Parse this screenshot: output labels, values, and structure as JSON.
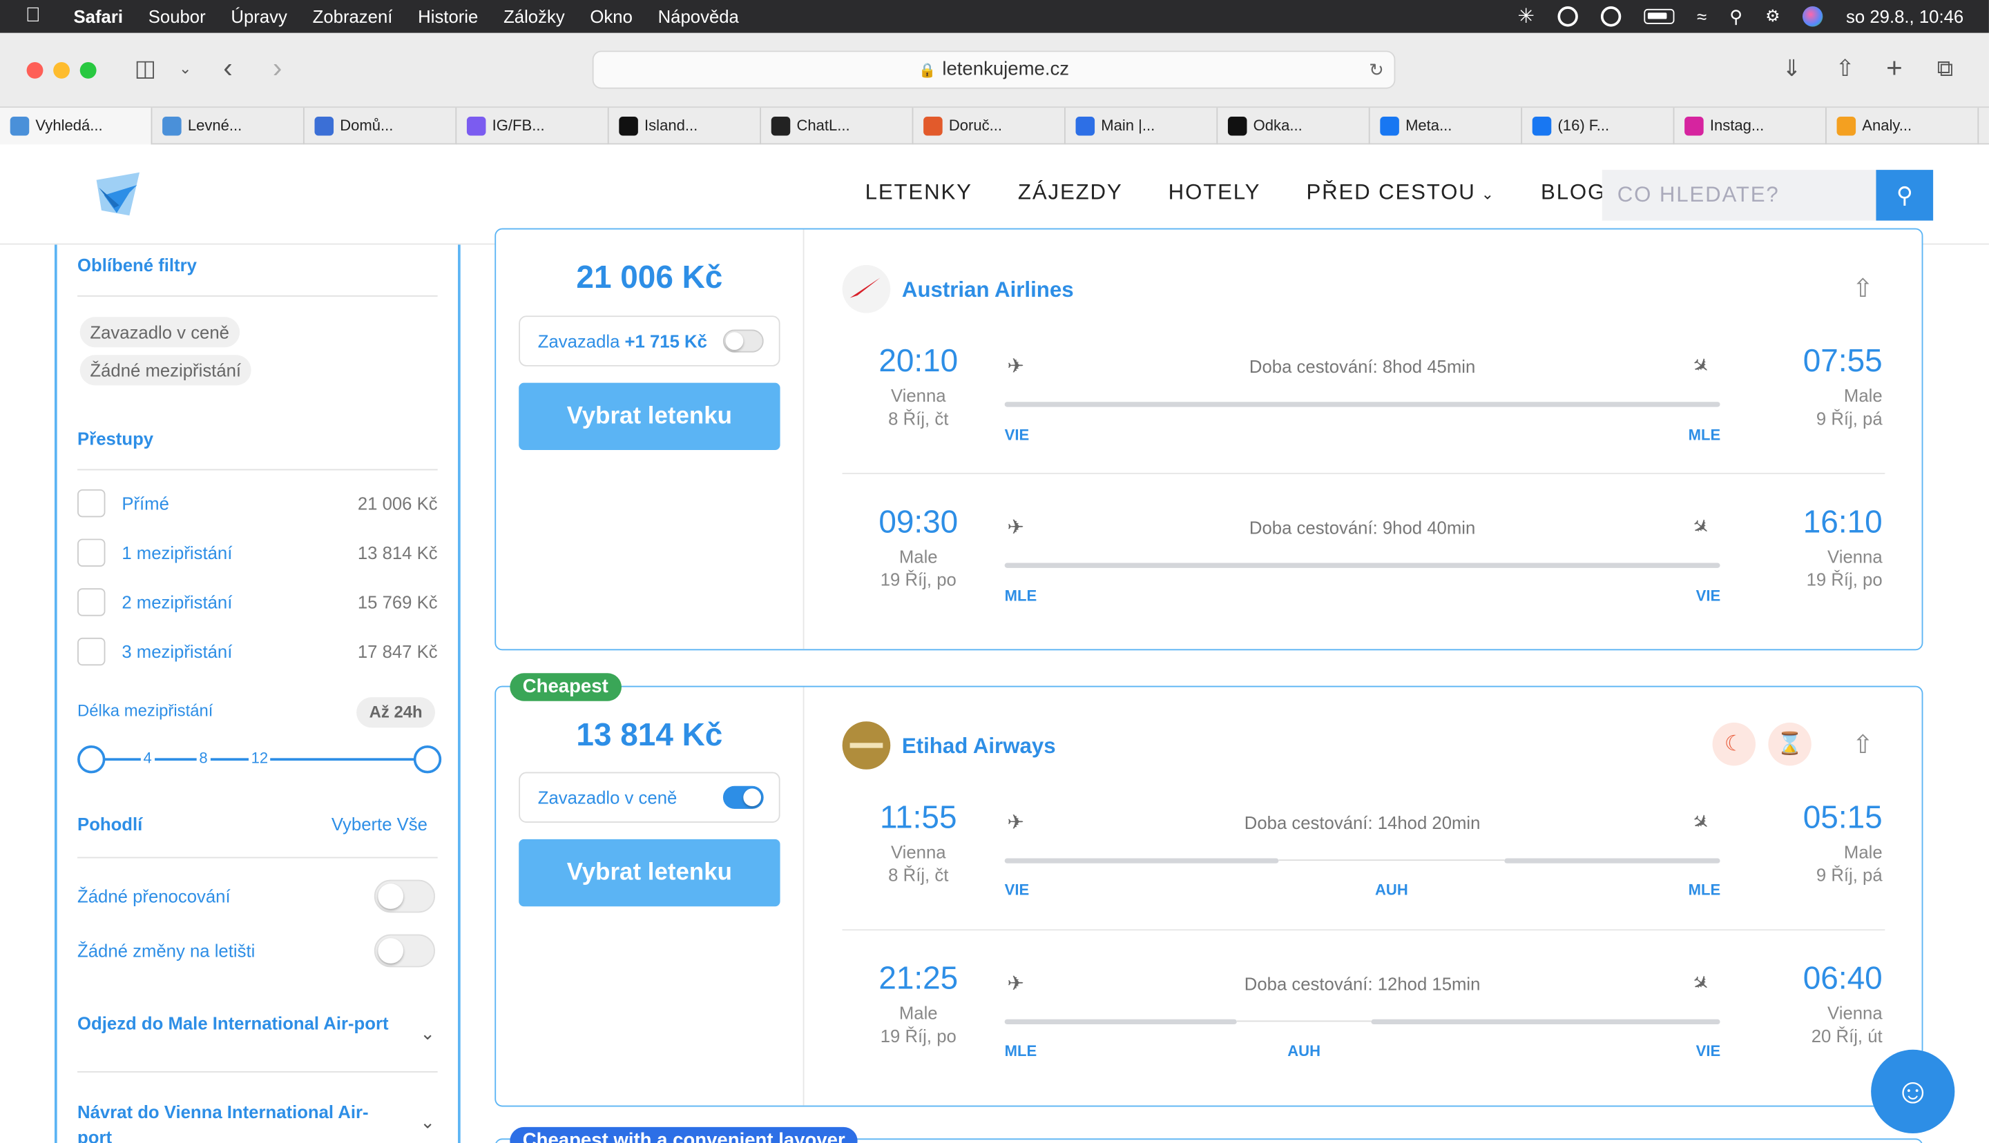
{
  "menubar": {
    "app": "Safari",
    "items": [
      "Soubor",
      "Úpravy",
      "Zobrazení",
      "Historie",
      "Záložky",
      "Okno",
      "Nápověda"
    ],
    "clock": "so 29.8., 10:46"
  },
  "browser": {
    "url": "letenkujeme.cz",
    "tabs": [
      {
        "label": "Vyhledá...",
        "color": "#4a90d9"
      },
      {
        "label": "Levné...",
        "color": "#4a90d9"
      },
      {
        "label": "Domů...",
        "color": "#3b6fd6"
      },
      {
        "label": "IG/FB...",
        "color": "#7b5cf0"
      },
      {
        "label": "Island...",
        "color": "#111111"
      },
      {
        "label": "ChatL...",
        "color": "#222222"
      },
      {
        "label": "Doruč...",
        "color": "#e25a2b"
      },
      {
        "label": "Main |...",
        "color": "#2d6fe6"
      },
      {
        "label": "Odka...",
        "color": "#111111"
      },
      {
        "label": "Meta...",
        "color": "#1877f2"
      },
      {
        "label": "(16) F...",
        "color": "#1877f2"
      },
      {
        "label": "Instag...",
        "color": "#d6249f"
      },
      {
        "label": "Analy...",
        "color": "#f4a020"
      }
    ]
  },
  "header": {
    "nav": [
      "LETENKY",
      "ZÁJEZDY",
      "HOTELY",
      "PŘED CESTOU",
      "BLOG"
    ],
    "search_placeholder": "CO HLEDATE?"
  },
  "sidebar": {
    "fav_title": "Oblíbené filtry",
    "fav_chips": [
      "Zavazadlo v ceně",
      "Žádné mezipřistání"
    ],
    "transfers_title": "Přestupy",
    "transfers": [
      {
        "label": "Přímé",
        "price": "21 006 Kč"
      },
      {
        "label": "1 mezipřistání",
        "price": "13 814 Kč"
      },
      {
        "label": "2 mezipřistání",
        "price": "15 769 Kč"
      },
      {
        "label": "3 mezipřistání",
        "price": "17 847 Kč"
      }
    ],
    "layover_label": "Délka mezipřistání",
    "layover_value": "Až 24h",
    "slider_ticks": [
      "4",
      "8",
      "12"
    ],
    "comfort_title": "Pohodlí",
    "select_all": "Vyberte Vše",
    "toggles": [
      "Žádné přenocování",
      "Žádné změny na letišti"
    ],
    "acc1": "Odjezd do Male International Air-port",
    "acc2": "Návrat do Vienna International Air-port"
  },
  "results": [
    {
      "price": "21 006 Kč",
      "bag_label": "Zavazadla",
      "bag_extra": "+1 715 Kč",
      "select": "Vybrat letenku",
      "airline": "Austrian Airlines",
      "legs": [
        {
          "dep_time": "20:10",
          "dep_city": "Vienna",
          "dep_date": "8 Říj, čt",
          "duration": "Doba cestování: 8hod 45min",
          "arr_time": "07:55",
          "arr_city": "Male",
          "arr_date": "9 Říj, pá",
          "from": "VIE",
          "to": "MLE"
        },
        {
          "dep_time": "09:30",
          "dep_city": "Male",
          "dep_date": "19 Říj, po",
          "duration": "Doba cestování: 9hod 40min",
          "arr_time": "16:10",
          "arr_city": "Vienna",
          "arr_date": "19 Říj, po",
          "from": "MLE",
          "to": "VIE"
        }
      ]
    },
    {
      "tag": "Cheapest",
      "price": "13 814 Kč",
      "bag_label": "Zavazadlo v ceně",
      "select": "Vybrat letenku",
      "airline": "Etihad Airways",
      "legs": [
        {
          "dep_time": "11:55",
          "dep_city": "Vienna",
          "dep_date": "8 Říj, čt",
          "duration": "Doba cestování: 14hod 20min",
          "arr_time": "05:15",
          "arr_city": "Male",
          "arr_date": "9 Říj, pá",
          "from": "VIE",
          "via": "AUH",
          "to": "MLE"
        },
        {
          "dep_time": "21:25",
          "dep_city": "Male",
          "dep_date": "19 Říj, po",
          "duration": "Doba cestování: 12hod 15min",
          "arr_time": "06:40",
          "arr_city": "Vienna",
          "arr_date": "20 Říj, út",
          "from": "MLE",
          "via": "AUH",
          "to": "VIE"
        }
      ]
    }
  ],
  "next_tag": "Cheapest with a convenient layover"
}
